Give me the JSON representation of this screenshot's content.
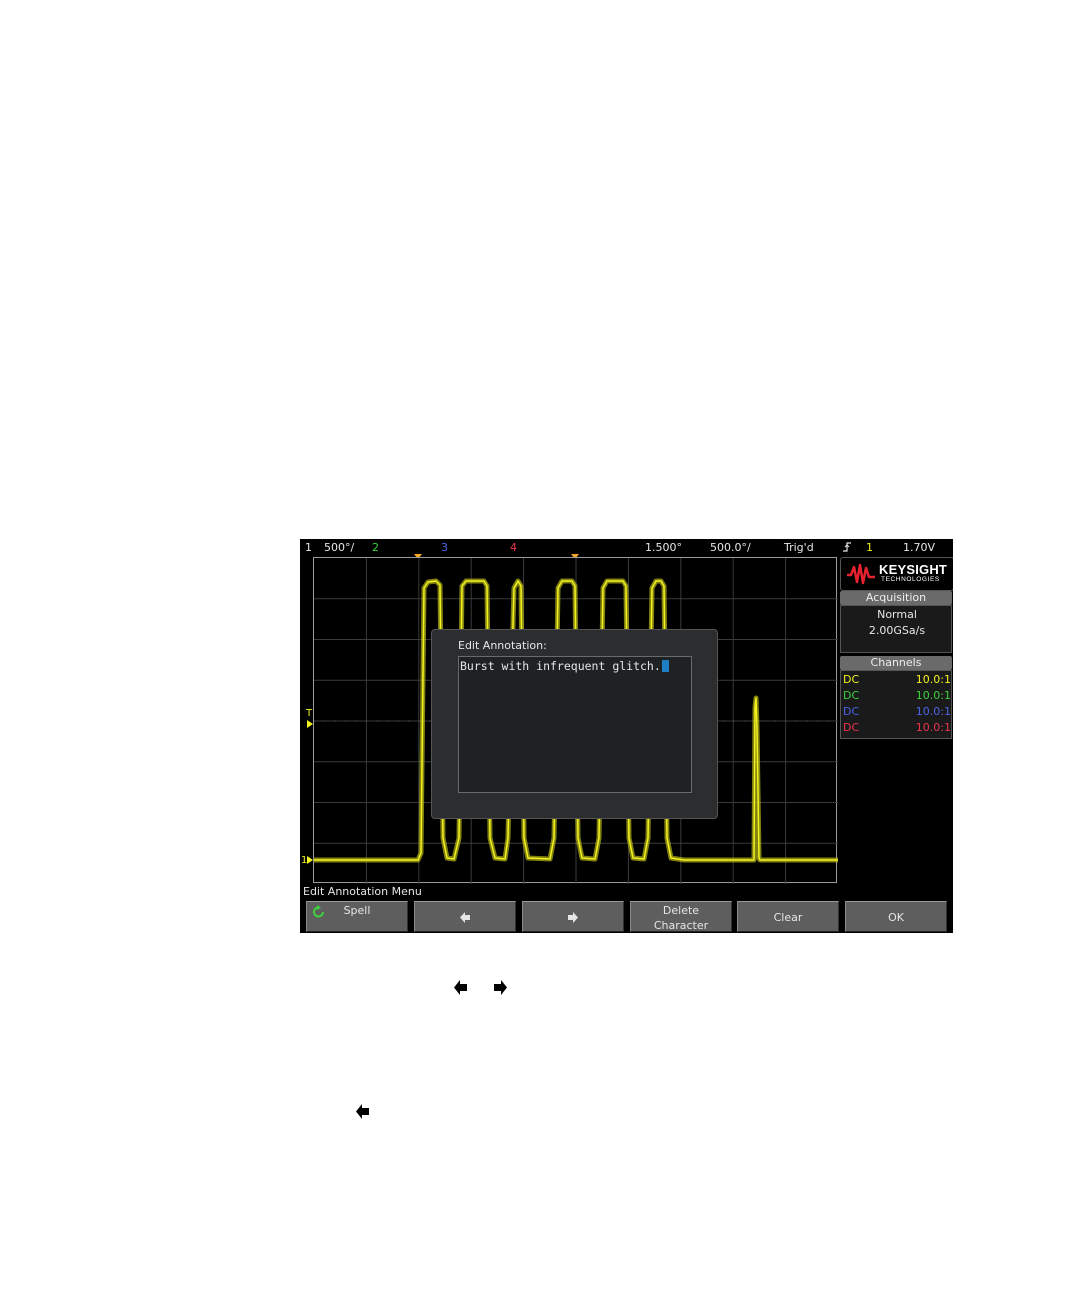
{
  "status_bar": {
    "ch1_num": "1",
    "ch1_scale": "500°/",
    "ch2_num": "2",
    "ch3_num": "3",
    "ch4_num": "4",
    "delay": "1.500°",
    "timebase": "500.0°/",
    "trigger_state": "Trig'd",
    "trigger_source": "1",
    "trigger_level": "1.70V"
  },
  "logo": {
    "brand": "KEYSIGHT",
    "sub": "TECHNOLOGIES"
  },
  "acquisition": {
    "title": "Acquisition",
    "mode": "Normal",
    "rate": "2.00GSa/s"
  },
  "channels": {
    "title": "Channels",
    "rows": [
      {
        "coupling": "DC",
        "probe": "10.0:1",
        "color": "#f2f21e"
      },
      {
        "coupling": "DC",
        "probe": "10.0:1",
        "color": "#3cd23c"
      },
      {
        "coupling": "DC",
        "probe": "10.0:1",
        "color": "#4d62e8"
      },
      {
        "coupling": "DC",
        "probe": "10.0:1",
        "color": "#e8344e"
      }
    ]
  },
  "markers": {
    "trigger_level_marker": "T",
    "ground_marker": "1"
  },
  "dialog": {
    "title": "Edit Annotation:",
    "text_value": "Burst with infrequent glitch."
  },
  "menu": {
    "title": "Edit Annotation Menu",
    "softkeys": {
      "spell": "Spell",
      "left_icon": "left-arrow-icon",
      "right_icon": "right-arrow-icon",
      "delete_line1": "Delete",
      "delete_line2": "Character",
      "clear": "Clear",
      "ok": "OK"
    }
  },
  "colors": {
    "ch1": "#f2f21e",
    "ch2": "#3cd23c",
    "ch3": "#4d62e8",
    "ch4": "#e8344e",
    "trigger_marker": "#f5a623",
    "cursor": "#1f7fc4"
  }
}
